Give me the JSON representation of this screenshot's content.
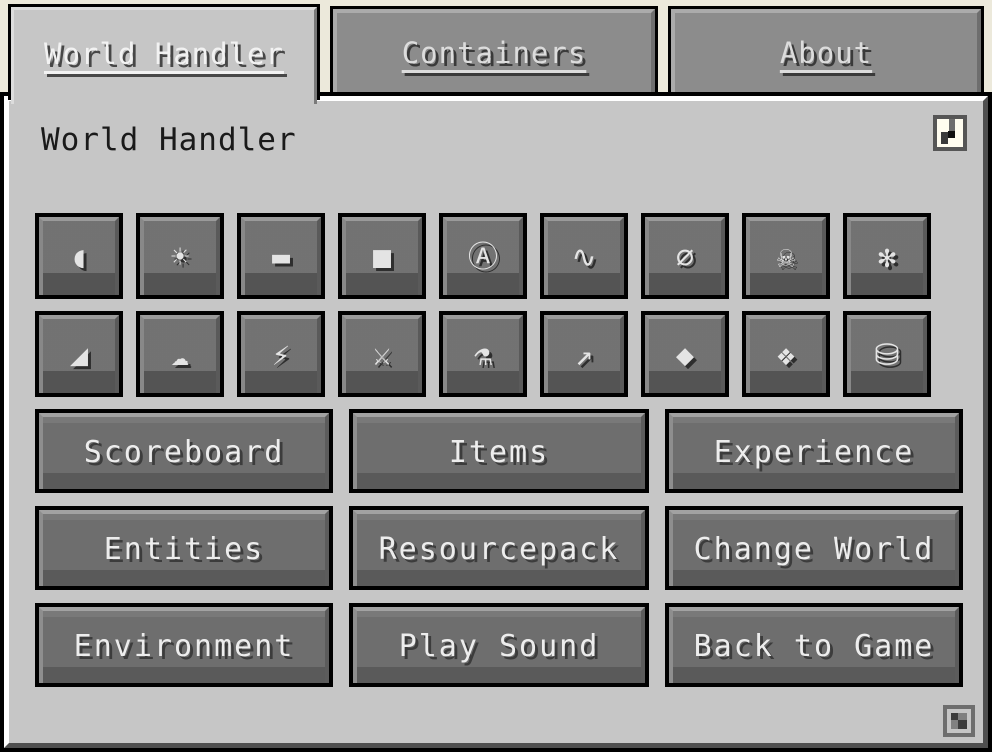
{
  "tabs": [
    {
      "label": "World Handler",
      "active": true
    },
    {
      "label": "Containers",
      "active": false
    },
    {
      "label": "About",
      "active": false
    }
  ],
  "window": {
    "title": "World Handler",
    "toggle_icon": "checkmark-toggle",
    "resize_icon": "resize-grip-icon"
  },
  "icon_rows": [
    [
      {
        "name": "time-sunrise-icon",
        "glyph": "◖"
      },
      {
        "name": "time-noon-sun-icon",
        "glyph": "☀"
      },
      {
        "name": "time-sunset-icon",
        "glyph": "▬"
      },
      {
        "name": "time-night-icon",
        "glyph": "■"
      },
      {
        "name": "game-mode-icon",
        "glyph": "Ⓐ"
      },
      {
        "name": "difficulty-wave-icon",
        "glyph": "∿"
      },
      {
        "name": "difficulty-peaceful-icon",
        "glyph": "⌀"
      },
      {
        "name": "difficulty-hard-icon",
        "glyph": "☠"
      },
      {
        "name": "settings-gear-icon",
        "glyph": "✻"
      }
    ],
    [
      {
        "name": "weather-clear-icon",
        "glyph": "◢"
      },
      {
        "name": "weather-rain-icon",
        "glyph": "☁"
      },
      {
        "name": "weather-thunder-icon",
        "glyph": "⚡"
      },
      {
        "name": "sword-icon",
        "glyph": "⚔"
      },
      {
        "name": "potion-icon",
        "glyph": "⚗"
      },
      {
        "name": "bow-icon",
        "glyph": "↗"
      },
      {
        "name": "block-diamond-icon",
        "glyph": "◆"
      },
      {
        "name": "block-ore-icon",
        "glyph": "❖"
      },
      {
        "name": "chest-icon",
        "glyph": "⛁"
      }
    ]
  ],
  "text_rows": [
    [
      {
        "name": "scoreboard-button",
        "label": "Scoreboard"
      },
      {
        "name": "items-button",
        "label": "Items"
      },
      {
        "name": "experience-button",
        "label": "Experience"
      }
    ],
    [
      {
        "name": "entities-button",
        "label": "Entities"
      },
      {
        "name": "resourcepack-button",
        "label": "Resourcepack"
      },
      {
        "name": "change-world-button",
        "label": "Change World"
      }
    ],
    [
      {
        "name": "environment-button",
        "label": "Environment"
      },
      {
        "name": "play-sound-button",
        "label": "Play Sound"
      },
      {
        "name": "back-to-game-button",
        "label": "Back to Game"
      }
    ]
  ],
  "colors": {
    "background": "#ECE9DB",
    "panel": "#C6C6C6",
    "button_face": "#6E6E6E",
    "tab_inactive": "#8C8C8C",
    "text_light": "#EDEDED",
    "text_dark": "#1A1A1A",
    "outline": "#000000"
  }
}
